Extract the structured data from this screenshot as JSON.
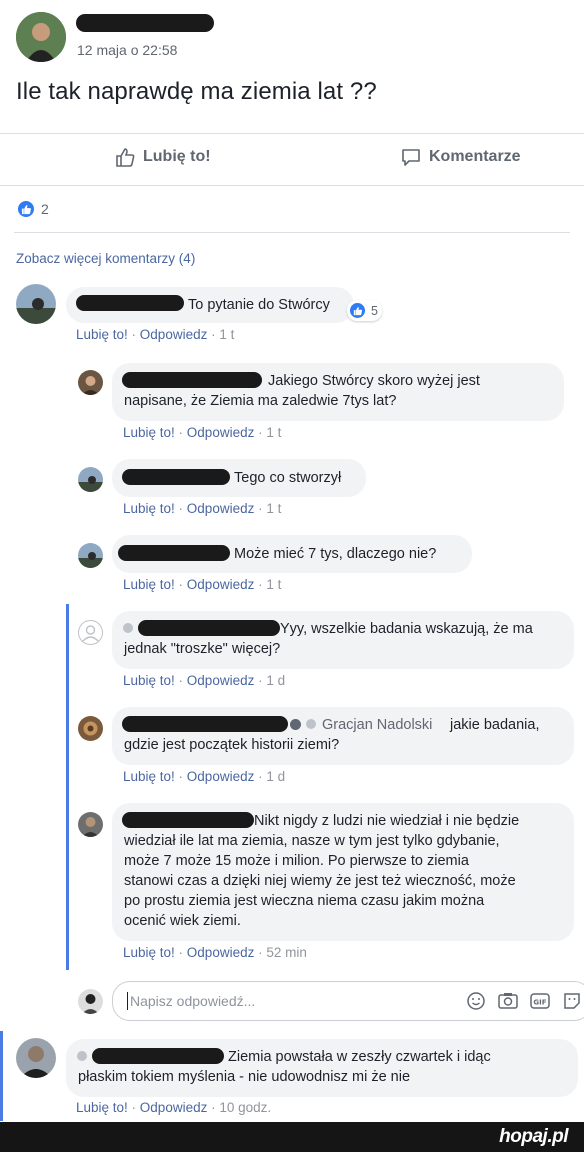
{
  "post": {
    "date": "12 maja o 22:58",
    "text": "Ile tak naprawdę ma ziemia lat ??",
    "like_label": "Lubię to!",
    "comment_label": "Komentarze",
    "reactions_count": "2",
    "see_more": "Zobacz więcej komentarzy (4)"
  },
  "actions": {
    "like": "Lubię to!",
    "reply": "Odpowiedz"
  },
  "comments": [
    {
      "text": "To pytanie do Stwórcy",
      "time": "1 t",
      "reactions": "5"
    },
    {
      "text": "Jakiego Stwórcy skoro wyżej jest\nnapisane, że Ziemia ma zaledwie 7tys lat?",
      "time": "1 t"
    },
    {
      "text": "Tego co stworzył",
      "time": "1 t"
    },
    {
      "text": "Może mieć 7 tys, dlaczego nie?",
      "time": "1 t"
    },
    {
      "text": "Yyy, wszelkie badania wskazują, że ma\njednak \"troszke\" więcej?",
      "time": "1 d"
    },
    {
      "tag": "Gracjan Nadolski",
      "text": " jakie badania,\ngdzie jest początek historii ziemi?",
      "time": "1 d"
    },
    {
      "text": "Nikt nigdy z ludzi nie wiedział i nie będzie\nwiedział ile lat ma ziemia, nasze w tym jest tylko gdybanie,\nmoże 7 może 15 może i milion. Po pierwsze to ziemia\nstanowi czas a dzięki niej wiemy że jest też wieczność, może\npo prostu ziemia jest wieczna niema czasu jakim można\nocenić wiek ziemi.",
      "time": "52 min"
    },
    {
      "text": "Ziemia powstała w zeszły czwartek i idąc\npłaskim tokiem myślenia - nie udowodnisz mi że nie",
      "time": "10 godz."
    }
  ],
  "reply_input": {
    "placeholder": "Napisz odpowiedź..."
  },
  "watermark": "hopaj.pl"
}
